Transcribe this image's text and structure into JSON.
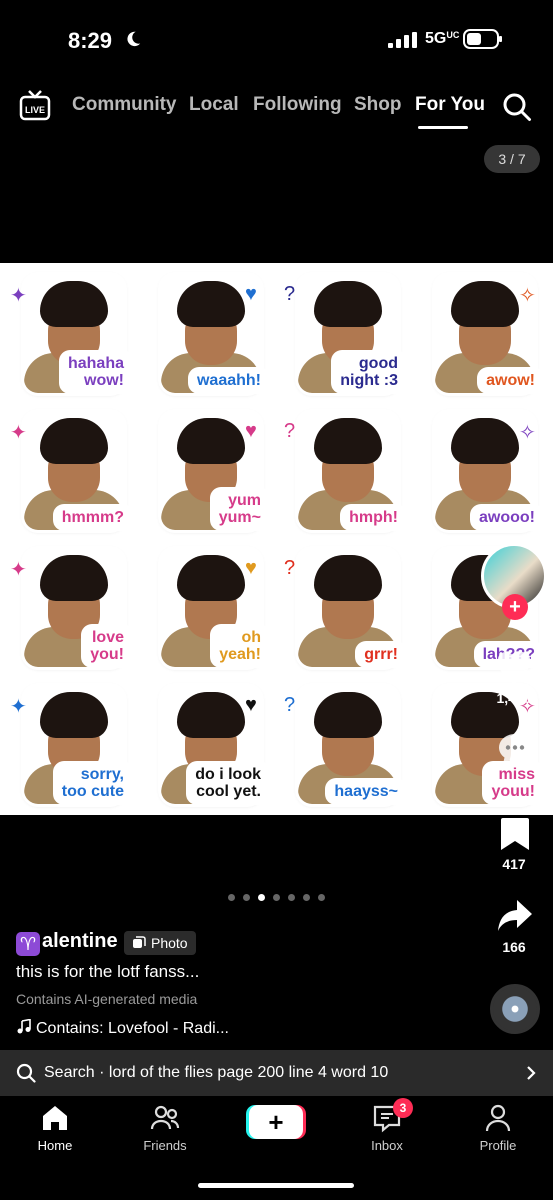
{
  "status": {
    "time": "8:29",
    "network": "5G",
    "network_suffix": "UC"
  },
  "nav": {
    "live_label": "LIVE",
    "tabs": [
      {
        "label": "Community",
        "active": false
      },
      {
        "label": "Local",
        "active": false
      },
      {
        "label": "Following",
        "active": false
      },
      {
        "label": "Shop",
        "active": false
      },
      {
        "label": "For You",
        "active": true
      }
    ]
  },
  "counter": "3 / 7",
  "stickers": [
    {
      "caption": "hahaha\nwow!",
      "color": "#7b3fbf"
    },
    {
      "caption": "waaahh!",
      "color": "#1f6fd1"
    },
    {
      "caption": "good\nnight :3",
      "color": "#2b2b8f"
    },
    {
      "caption": "awow!",
      "color": "#e0561f"
    },
    {
      "caption": "hmmm?",
      "color": "#d63b8a"
    },
    {
      "caption": "yum\nyum~",
      "color": "#d63b8a"
    },
    {
      "caption": "hmph!",
      "color": "#d63b8a"
    },
    {
      "caption": "awooo!",
      "color": "#7b3fbf"
    },
    {
      "caption": "love\nyou!",
      "color": "#d63b8a"
    },
    {
      "caption": "oh\nyeah!",
      "color": "#e09a1f"
    },
    {
      "caption": "grrr!",
      "color": "#e0301f"
    },
    {
      "caption": "lah???",
      "color": "#7b3fbf"
    },
    {
      "caption": "sorry,\ntoo cute",
      "color": "#1f6fd1"
    },
    {
      "caption": "do i look\ncool yet.",
      "color": "#111111"
    },
    {
      "caption": "haayss~",
      "color": "#1f6fd1"
    },
    {
      "caption": "miss\nyouu!",
      "color": "#d63b8a"
    }
  ],
  "rail": {
    "likes": "1,408",
    "saves": "417",
    "shares": "166"
  },
  "carousel": {
    "count": 7,
    "active_index": 2
  },
  "post": {
    "username": "alentine",
    "username_emoji": "♈",
    "badge": "Photo",
    "description": "this is for the lotf fanss...",
    "ai_note": "Contains AI-generated media",
    "music": "Contains: Lovefool - Radi..."
  },
  "search": {
    "text": "Search · lord of the flies page 200 line 4 word 10"
  },
  "bottom_nav": {
    "home": "Home",
    "friends": "Friends",
    "create": "+",
    "inbox": "Inbox",
    "inbox_badge": "3",
    "profile": "Profile"
  },
  "colors": {
    "accent_red": "#fe2c55",
    "accent_cyan": "#25f4ee"
  }
}
